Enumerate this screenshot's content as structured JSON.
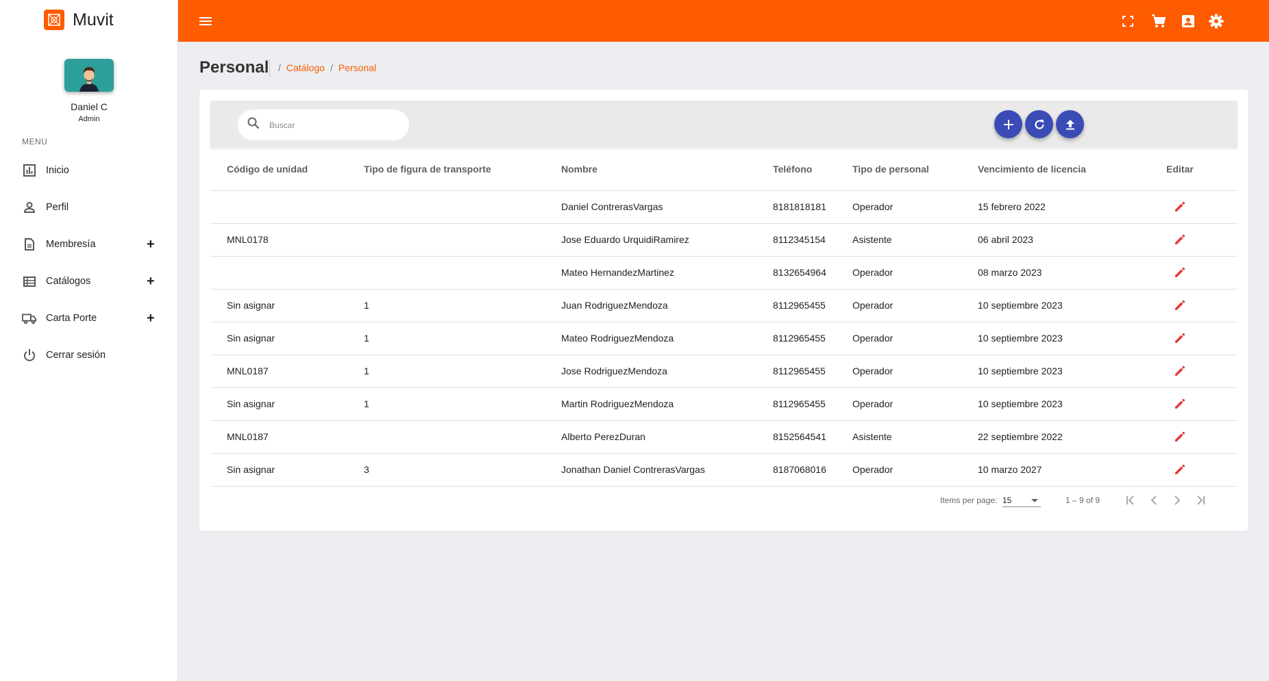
{
  "app": {
    "name": "Muvit"
  },
  "user": {
    "name": "Daniel C",
    "role": "Admin"
  },
  "sidebar": {
    "menu_label": "MENU",
    "items": [
      {
        "label": "Inicio",
        "icon": "bar-chart-icon",
        "expandable": false
      },
      {
        "label": "Perfil",
        "icon": "person-icon",
        "expandable": false
      },
      {
        "label": "Membresía",
        "icon": "document-icon",
        "expandable": true
      },
      {
        "label": "Catálogos",
        "icon": "list-icon",
        "expandable": true
      },
      {
        "label": "Carta Porte",
        "icon": "truck-icon",
        "expandable": true
      },
      {
        "label": "Cerrar sesión",
        "icon": "power-icon",
        "expandable": false
      }
    ],
    "expand_symbol": "+"
  },
  "topbar": {
    "icons": [
      "menu-icon",
      "fullscreen-icon",
      "cart-icon",
      "contact-icon",
      "settings-icon"
    ]
  },
  "header": {
    "title": "Personal",
    "breadcrumbs": [
      "Catálogo",
      "Personal"
    ],
    "separator": "/"
  },
  "search": {
    "placeholder": "Buscar",
    "value": ""
  },
  "actions": [
    "add-icon",
    "refresh-icon",
    "upload-icon"
  ],
  "table": {
    "columns": [
      "Código de unidad",
      "Tipo de figura de transporte",
      "Nombre",
      "Teléfono",
      "Tipo de personal",
      "Vencimiento de licencia",
      "Editar"
    ],
    "rows": [
      {
        "codigo": "",
        "tipo_figura": "",
        "nombre": "Daniel ContrerasVargas",
        "telefono": "8181818181",
        "tipo_personal": "Operador",
        "vencimiento": "15 febrero 2022"
      },
      {
        "codigo": "MNL0178",
        "tipo_figura": "",
        "nombre": "Jose Eduardo UrquidiRamirez",
        "telefono": "8112345154",
        "tipo_personal": "Asistente",
        "vencimiento": "06 abril 2023"
      },
      {
        "codigo": "",
        "tipo_figura": "",
        "nombre": "Mateo HernandezMartinez",
        "telefono": "8132654964",
        "tipo_personal": "Operador",
        "vencimiento": "08 marzo 2023"
      },
      {
        "codigo": "Sin asignar",
        "tipo_figura": "1",
        "nombre": "Juan RodriguezMendoza",
        "telefono": "8112965455",
        "tipo_personal": "Operador",
        "vencimiento": "10 septiembre 2023"
      },
      {
        "codigo": "Sin asignar",
        "tipo_figura": "1",
        "nombre": "Mateo RodriguezMendoza",
        "telefono": "8112965455",
        "tipo_personal": "Operador",
        "vencimiento": "10 septiembre 2023"
      },
      {
        "codigo": "MNL0187",
        "tipo_figura": "1",
        "nombre": "Jose RodriguezMendoza",
        "telefono": "8112965455",
        "tipo_personal": "Operador",
        "vencimiento": "10 septiembre 2023"
      },
      {
        "codigo": "Sin asignar",
        "tipo_figura": "1",
        "nombre": "Martin RodriguezMendoza",
        "telefono": "8112965455",
        "tipo_personal": "Operador",
        "vencimiento": "10 septiembre 2023"
      },
      {
        "codigo": "MNL0187",
        "tipo_figura": "",
        "nombre": "Alberto PerezDuran",
        "telefono": "8152564541",
        "tipo_personal": "Asistente",
        "vencimiento": "22 septiembre 2022"
      },
      {
        "codigo": "Sin asignar",
        "tipo_figura": "3",
        "nombre": "Jonathan Daniel ContrerasVargas",
        "telefono": "8187068016",
        "tipo_personal": "Operador",
        "vencimiento": "10 marzo 2027"
      }
    ]
  },
  "paginator": {
    "items_label": "Items per page:",
    "page_size": "15",
    "range": "1 – 9 of 9"
  },
  "colors": {
    "brand": "#ff5b00",
    "accent": "#3b4bb5",
    "edit": "#e53935",
    "avatar_bg": "#2d9f9b"
  }
}
